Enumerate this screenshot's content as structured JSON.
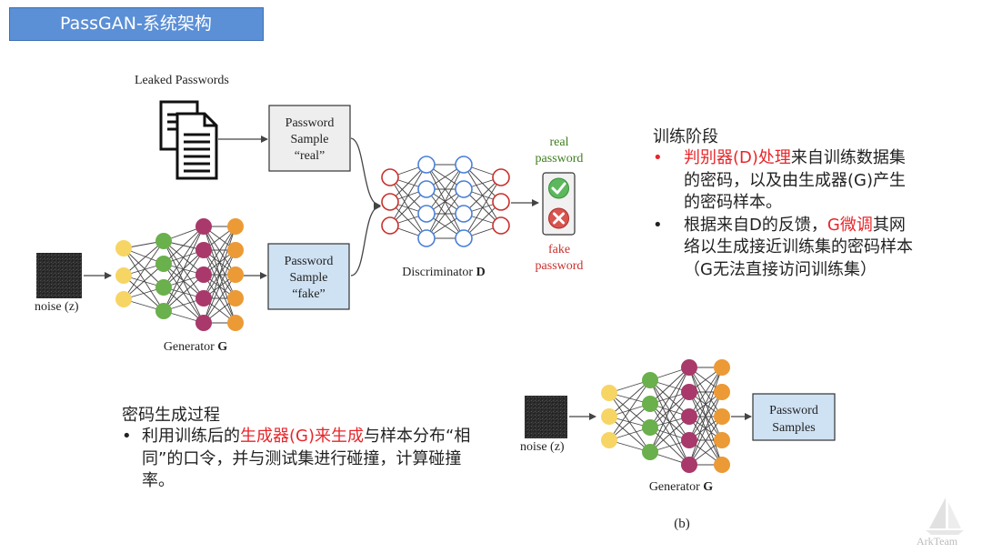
{
  "slide": {
    "title": "PassGAN-系统架构",
    "watermark": "ArkTeam"
  },
  "diagram_a": {
    "leaked_label": "Leaked Passwords",
    "sample_real": [
      "Password",
      "Sample",
      "“real”"
    ],
    "sample_fake": [
      "Password",
      "Sample",
      "“fake”"
    ],
    "noise_label": "noise (z)",
    "generator_label": "Generator ",
    "generator_symbol": "G",
    "discriminator_label": "Discriminator ",
    "discriminator_symbol": "D",
    "real_out": [
      "real",
      "password"
    ],
    "fake_out": [
      "fake",
      "password"
    ]
  },
  "diagram_b": {
    "noise_label": "noise (z)",
    "generator_label": "Generator ",
    "generator_symbol": "G",
    "samples": [
      "Password",
      "Samples"
    ],
    "caption": "(b)"
  },
  "training": {
    "heading": "训练阶段",
    "items": [
      {
        "bullet": "•",
        "highlight": "判别器(D)处理",
        "text": "来自训练数据集的密码，以及由生成器(G)产生的密码样本。"
      },
      {
        "bullet": "•",
        "pre": "根据来自D的反馈，",
        "highlight": "G微调",
        "text": "其网络以生成接近训练集的密码样本（G无法直接访问训练集）"
      }
    ]
  },
  "generation": {
    "heading": "密码生成过程",
    "items": [
      {
        "bullet": "•",
        "pre": "利用训练后的",
        "highlight": "生成器(G)来生成",
        "text": "与样本分布“相同”的口令，并与测试集进行碰撞，计算碰撞率。"
      }
    ]
  },
  "colors": {
    "title_bar": "#5b8fd6",
    "layer_yellow": "#f7d565",
    "layer_green": "#6ab04c",
    "layer_purple": "#a8396a",
    "layer_orange": "#eb9a35",
    "disc_red": "#c9302c",
    "disc_blue": "#4a80d9",
    "fake_box": "#cfe2f3",
    "real_box": "#eeeeee",
    "label_green": "#3f7d1e",
    "label_red": "#c9302c",
    "highlight_red": "#e8262a"
  }
}
